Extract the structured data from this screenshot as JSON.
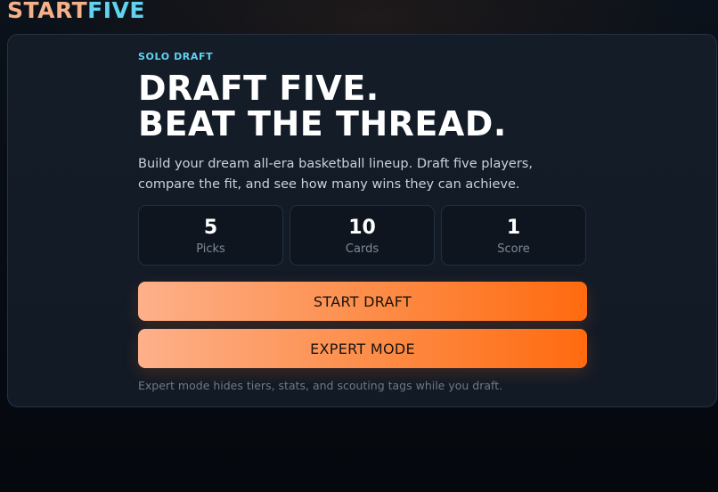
{
  "brand": {
    "part1": "START",
    "part2": "FIVE"
  },
  "hero": {
    "eyebrow": "SOLO DRAFT",
    "headline_line1": "DRAFT FIVE.",
    "headline_line2": "BEAT THE THREAD.",
    "lede": "Build your dream all-era basketball lineup. Draft five players, compare the fit, and see how many wins they can achieve."
  },
  "stats": [
    {
      "value": "5",
      "label": "Picks"
    },
    {
      "value": "10",
      "label": "Cards"
    },
    {
      "value": "1",
      "label": "Score"
    }
  ],
  "actions": {
    "start_label": "START DRAFT",
    "expert_label": "EXPERT MODE",
    "expert_note": "Expert mode hides tiers, stats, and scouting tags while you draft."
  },
  "colors": {
    "background": "#070b12",
    "panel": "#141c28",
    "accent_cyan": "#5fd3ef",
    "brand_peach": "#f5b08a",
    "button_gradient_start": "#fdb08a",
    "button_gradient_end": "#ff6a0f"
  }
}
